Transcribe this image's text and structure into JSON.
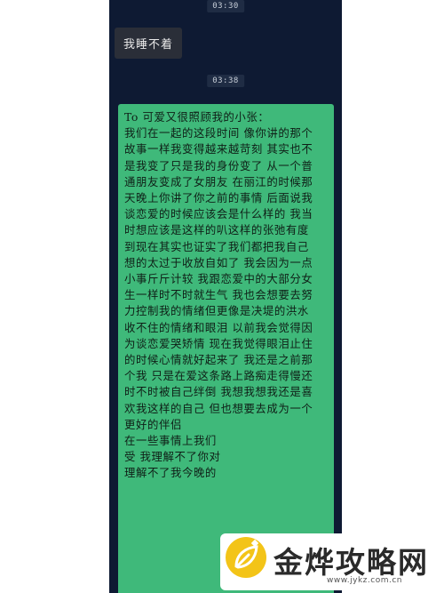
{
  "chat": {
    "timestamps": [
      "03:30",
      "03:38"
    ],
    "incoming_message": "我睡不着",
    "outgoing_letter_lines": [
      "To 可爱又很照顾我的小张：",
      "我们在一起的这段时间 像你讲的那个",
      "故事一样我变得越来越苛刻 其实也不",
      "是我变了只是我的身份变了 从一个普",
      "通朋友变成了女朋友 在丽江的时候那",
      "天晚上你讲了你之前的事情 后面说我",
      "谈恋爱的时候应该会是什么样的 我当",
      "时想应该是这样的叭这样的张弛有度",
      "到现在其实也证实了我们都把我自己",
      "想的太过于收放自如了 我会因为一点",
      "小事斤斤计较 我跟恋爱中的大部分女",
      "生一样时不时就生气 我也会想要去努",
      "力控制我的情绪但更像是决堤的洪水",
      "收不住的情绪和眼泪 以前我会觉得因",
      "为谈恋爱哭矫情 现在我觉得眼泪止住",
      "的时候心情就好起来了 我还是之前那",
      "个我 只是在爱这条路上路痴走得慢还",
      "时不时被自己绊倒 我想我想我还是喜",
      "欢我这样的自己 但也想要去成为一个",
      "更好的伴侣",
      "在一些事情上我们",
      "受 我理解不了你对",
      "理解不了我今晚的"
    ]
  },
  "watermark": {
    "brand": "金烨攻略网",
    "url": "www.jykz.com.cn"
  },
  "colors": {
    "chat_background": "#0e1a33",
    "outgoing_bubble": "#3fb97a",
    "incoming_bubble": "#2a2e38",
    "logo_yellow": "#f3c418"
  }
}
